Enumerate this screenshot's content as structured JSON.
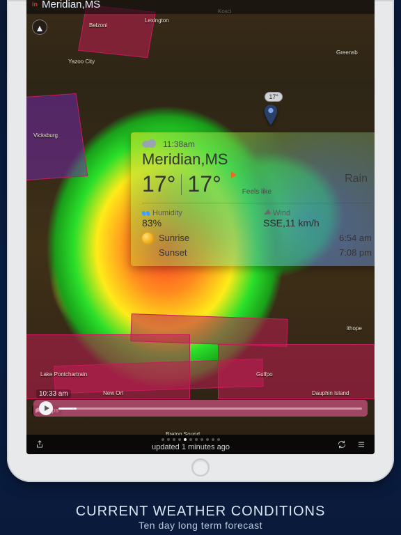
{
  "header": {
    "brand": "in",
    "location": "Meridian,MS"
  },
  "pin": {
    "temp": "17°"
  },
  "card": {
    "time": "11:38am",
    "location": "Meridian,MS",
    "temp": "17°",
    "feels_temp": "17°",
    "feels_label": "Feels like",
    "condition": "Rain",
    "humidity_label": "Humidity",
    "humidity": "83%",
    "wind_label": "Wind",
    "wind": "SSE,11 km/h",
    "sunrise_label": "Sunrise",
    "sunrise": "6:54 am",
    "sunset_label": "Sunset",
    "sunset": "7:08 pm"
  },
  "timeline": {
    "time": "10:33 am"
  },
  "maps_badge": "Maps",
  "status": {
    "updated": "updated 1 minutes ago"
  },
  "map_cities": {
    "belzoni": "Belzoni",
    "lexington": "Lexington",
    "kosci": "Kosci",
    "yazoo": "Yazoo City",
    "vicksburg": "Vicksburg",
    "greensb": "Greensb",
    "pontchartrain": "Lake Pontchartrain",
    "neworleans": "New Orl",
    "bretonsound": "Breton Sound",
    "gulfpo": "Gulfpo",
    "dauphin": "Dauphin Island",
    "chope": "ithope"
  },
  "promo": {
    "line1": "CURRENT WEATHER CONDITIONS",
    "line2": "Ten day long term forecast"
  }
}
